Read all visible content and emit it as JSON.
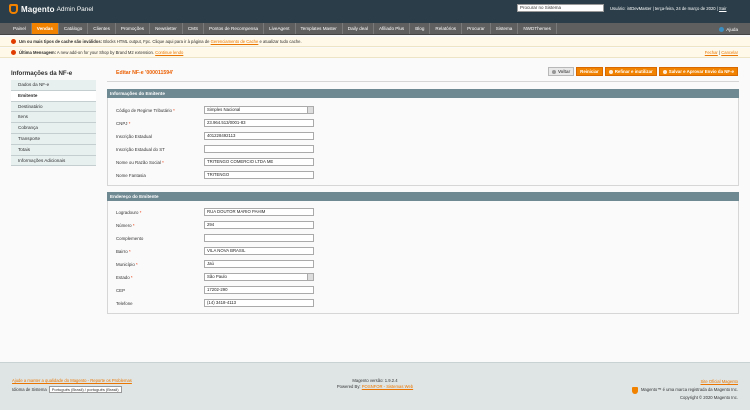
{
  "header": {
    "brand": "Magento",
    "panel": "Admin Panel",
    "search_value": "Procurar no Sistema",
    "user_prefix": "Usuário: ",
    "user_name": "intDevMaster",
    "date_text": " | terça-feira, 24 de março de 2020 | ",
    "logout": "Sair"
  },
  "nav": {
    "items": [
      "Painel",
      "Vendas",
      "Catálogo",
      "Clientes",
      "Promoções",
      "Newsletter",
      "CMS",
      "Pontos de Recompensa",
      "LiveAgent",
      "Templates Master",
      "Daily deal",
      "Afiliado Plus",
      "Blog",
      "Relatórios",
      "Procurar",
      "Sistema",
      "NWDThemes"
    ],
    "active_index": 1,
    "help": "Ajuda"
  },
  "notices": {
    "cache_bold": "Um ou mais tipos de cache são inválidos:",
    "cache_text": " Blocks HTML output, Fpc. Clique aqui para ir à página de ",
    "cache_link": "Gerenciamento de Cache",
    "cache_tail": " e atualizar tudo cache.",
    "msg_bold": "Última Mensagem:",
    "msg_text": " A new add-on for your Shop by Brand M2 extension. ",
    "msg_link": "Continue lendo",
    "close": "Fechar",
    "remove": "Cancelar"
  },
  "sidebar": {
    "title": "Informações da NF-e",
    "tabs": [
      "Dados da NF-e",
      "Emitente",
      "Destinatário",
      "Itens",
      "Cobrança",
      "Transporte",
      "Totais",
      "Informações Adicionais"
    ],
    "active_index": 1
  },
  "page": {
    "title": "Editar NF-e '000011594'",
    "buttons": {
      "back": "Voltar",
      "reset": "Reiniciar",
      "refuse": "Refinar e inutilizar",
      "save_approve": "Salvar e Aprovar Envio da NF-e"
    }
  },
  "emitente": {
    "title": "Informações do Emitente",
    "fields": [
      {
        "label": "Código de Regime Tributário",
        "required": true,
        "value": "Simples Nacional",
        "select": true
      },
      {
        "label": "CNPJ",
        "required": true,
        "value": "23.964.513/0001-83",
        "select": false
      },
      {
        "label": "Inscrição Estadual",
        "required": false,
        "value": "401228492113",
        "select": false
      },
      {
        "label": "Inscrição Estadual do ST",
        "required": false,
        "value": "",
        "select": false
      },
      {
        "label": "Nome ou Razão Social",
        "required": true,
        "value": "TRITENGO COMERCIO LTDA  ME",
        "select": false
      },
      {
        "label": "Nome Fantasia",
        "required": false,
        "value": "TRITENGO",
        "select": false
      }
    ]
  },
  "endereco": {
    "title": "Endereço do Emitente",
    "fields": [
      {
        "label": "Logradouro",
        "required": true,
        "value": "RUA DOUTOR MARIO PAHIM",
        "select": false
      },
      {
        "label": "Número",
        "required": true,
        "value": "294",
        "select": false
      },
      {
        "label": "Complemento",
        "required": false,
        "value": "",
        "select": false
      },
      {
        "label": "Bairro",
        "required": true,
        "value": "VILA NOVA BRASIL",
        "select": false
      },
      {
        "label": "Município",
        "required": true,
        "value": "Jaú",
        "select": false
      },
      {
        "label": "Estado",
        "required": true,
        "value": "São Paulo",
        "select": true
      },
      {
        "label": "CEP",
        "required": false,
        "value": "17202-290",
        "select": false
      },
      {
        "label": "Telefone",
        "required": false,
        "value": "(14) 3418-4113",
        "select": false
      }
    ]
  },
  "footer": {
    "help_link": "Ajude a manter a qualidade do Magento - Reporte os Problemas",
    "locale_label": "Idioma de Sistema",
    "locale_value": "Português (Brasil) / português (Brasil)",
    "version": "Magento versão: 1.9.2.4",
    "powered_prefix": "Powered By: ",
    "powered_link": "POSNFOR - Sistemas Web",
    "official_site": "Site Oficial Magento",
    "trademark": "Magento™ é uma marca registrada da Magento Inc.",
    "copyright": "Copyright © 2020 Magento Inc."
  }
}
